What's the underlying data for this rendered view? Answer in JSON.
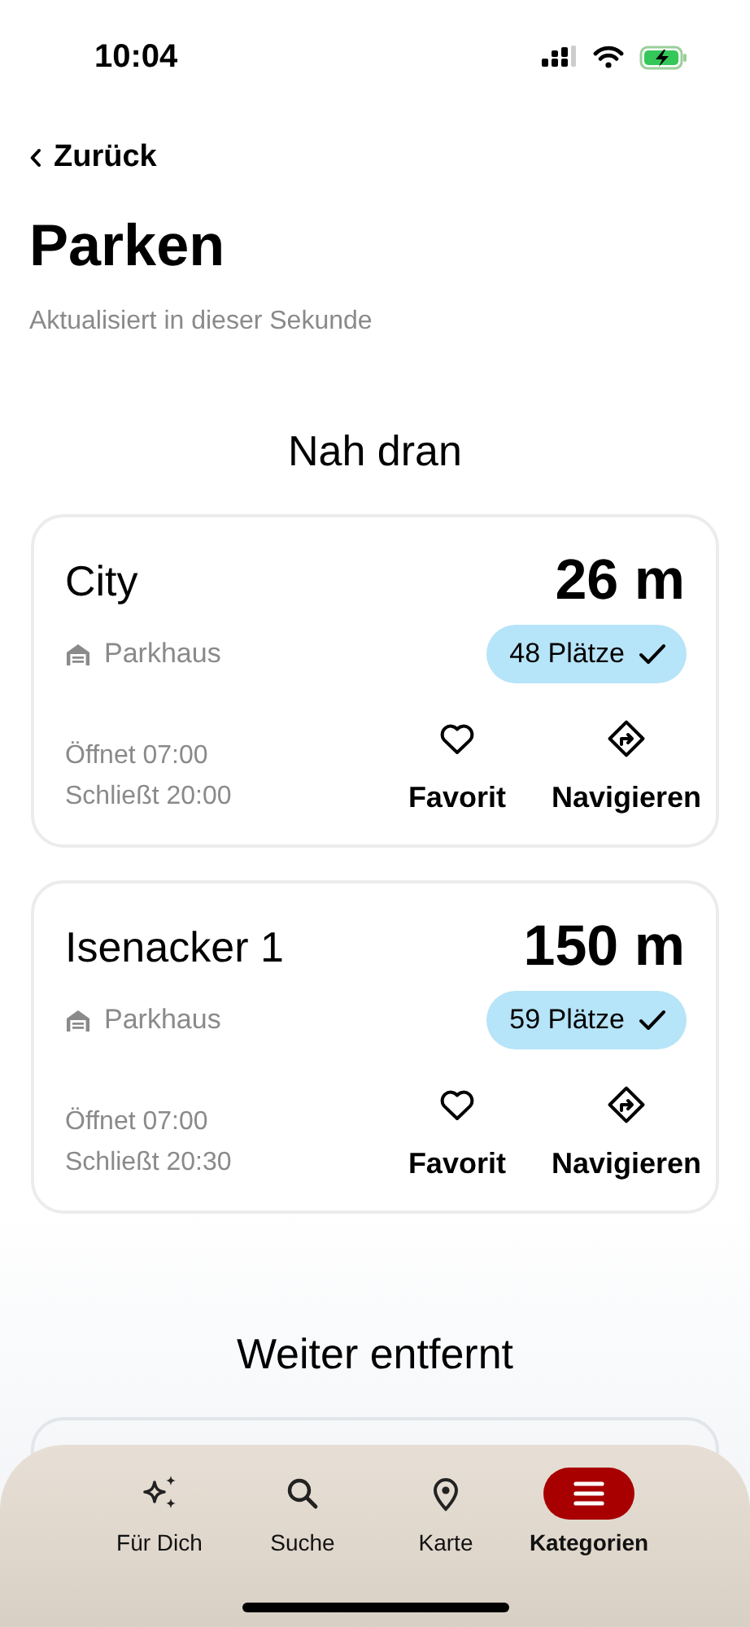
{
  "status_bar": {
    "time": "10:04"
  },
  "back_link": {
    "label": "Zurück"
  },
  "title": "Parken",
  "subtitle": "Aktualisiert in dieser Sekunde",
  "sections": [
    {
      "heading": "Nah dran",
      "cards": [
        {
          "name": "City",
          "distance": "26 m",
          "type": "Parkhaus",
          "spaces": "48 Plätze",
          "opens": "Öffnet 07:00",
          "closes": "Schließt 20:00",
          "actions": [
            {
              "kind": "favorite",
              "label": "Favorit"
            },
            {
              "kind": "navigate",
              "label": "Navigieren"
            }
          ]
        },
        {
          "name": "Isenacker 1",
          "distance": "150 m",
          "type": "Parkhaus",
          "spaces": "59 Plätze",
          "opens": "Öffnet 07:00",
          "closes": "Schließt 20:30",
          "actions": [
            {
              "kind": "favorite",
              "label": "Favorit"
            },
            {
              "kind": "navigate",
              "label": "Navigieren"
            }
          ]
        }
      ]
    },
    {
      "heading": "Weiter entfernt"
    }
  ],
  "tab_bar": [
    {
      "kind": "sparkles",
      "label": "Für Dich",
      "selected": false
    },
    {
      "kind": "search",
      "label": "Suche",
      "selected": false
    },
    {
      "kind": "map",
      "label": "Karte",
      "selected": false
    },
    {
      "kind": "menu",
      "label": "Kategorien",
      "selected": true
    }
  ]
}
